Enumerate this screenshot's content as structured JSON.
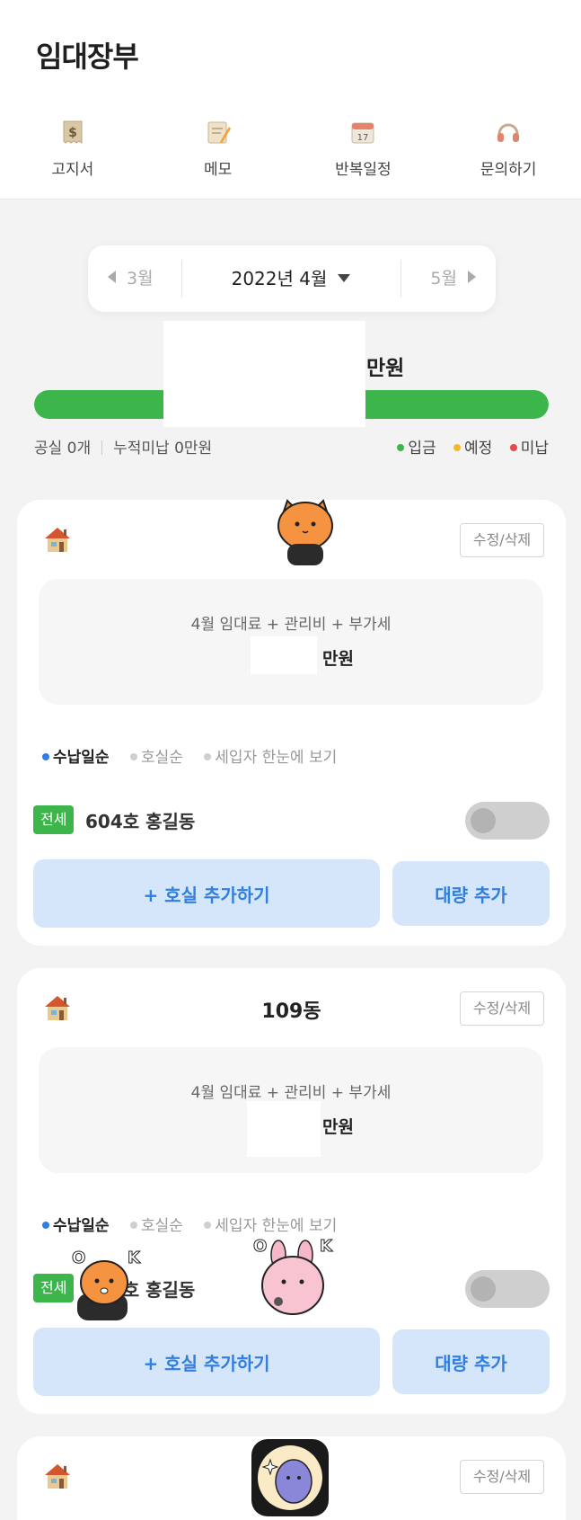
{
  "app": {
    "title": "임대장부"
  },
  "nav": [
    {
      "icon": "receipt-icon",
      "label": "고지서"
    },
    {
      "icon": "memo-icon",
      "label": "메모"
    },
    {
      "icon": "calendar-icon",
      "label": "반복일정"
    },
    {
      "icon": "headset-icon",
      "label": "문의하기"
    }
  ],
  "month": {
    "prev": "3월",
    "current": "2022년 4월",
    "next": "5월"
  },
  "total": {
    "amount": "",
    "unit": "만원",
    "progress_percent": 100
  },
  "summary": {
    "vacancy": "공실 0개",
    "overdue": "누적미납 0만원"
  },
  "legend": [
    {
      "label": "입금",
      "color": "#3cb64a"
    },
    {
      "label": "예정",
      "color": "#f5b731"
    },
    {
      "label": "미납",
      "color": "#e5484d"
    }
  ],
  "buildings": [
    {
      "name": "",
      "edit_label": "수정/삭제",
      "rent_label": "4월 임대료 + 관리비 + 부가세",
      "rent_amount": "",
      "rent_unit": "만원",
      "sort": [
        "수납일순",
        "호실순",
        "세입자 한눈에 보기"
      ],
      "sort_active_index": 0,
      "sort_dot_color": "#2f7ee0",
      "unit": {
        "type": "전세",
        "name": "604호 홍길동",
        "toggle_on": false
      },
      "add_label": "+ 호실 추가하기",
      "bulk_label": "대량 추가"
    },
    {
      "name": "109동",
      "edit_label": "수정/삭제",
      "rent_label": "4월 임대료 + 관리비 + 부가세",
      "rent_amount": "",
      "rent_unit": "만원",
      "sort": [
        "수납일순",
        "호실순",
        "세입자 한눈에 보기"
      ],
      "sort_active_index": 0,
      "sort_dot_color": "#2f7ee0",
      "unit": {
        "type": "전세",
        "name": "604호 홍길동",
        "toggle_on": false
      },
      "add_label": "+ 호실 추가하기",
      "bulk_label": "대량 추가"
    },
    {
      "name": "",
      "edit_label": "수정/삭제"
    }
  ]
}
